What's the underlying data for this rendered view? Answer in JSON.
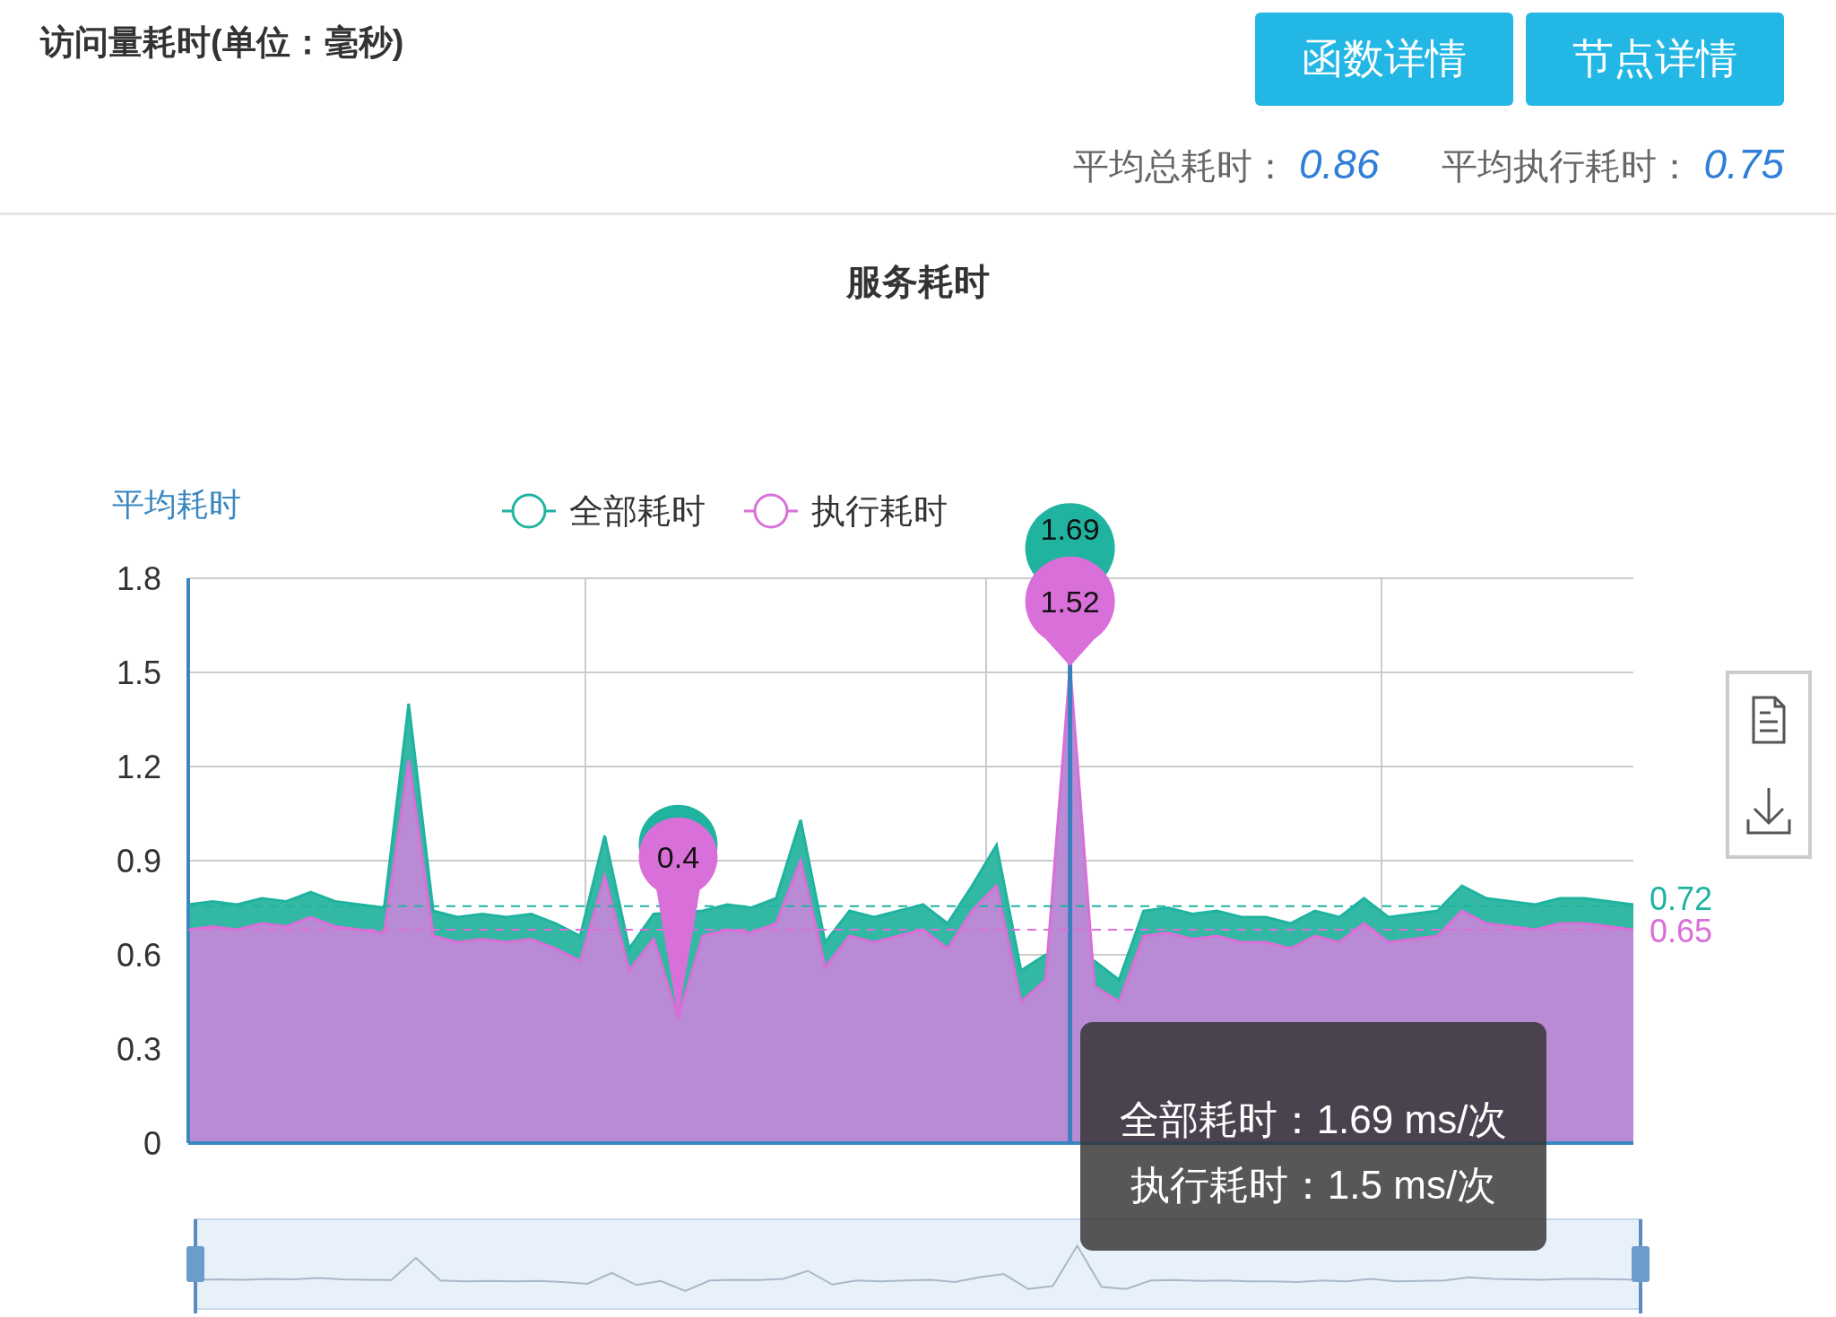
{
  "header": {
    "title": "访问量耗时(单位：毫秒)",
    "buttons": [
      "函数详情",
      "节点详情"
    ],
    "stats": [
      {
        "label": "平均总耗时：",
        "value": "0.86"
      },
      {
        "label": "平均执行耗时：",
        "value": "0.75"
      }
    ]
  },
  "chart": {
    "title": "服务耗时",
    "chart_data": {
      "type": "area",
      "ylabel": "平均耗时",
      "ylim": [
        0,
        1.8
      ],
      "yticks": [
        0,
        0.3,
        0.6,
        0.9,
        1.2,
        1.5,
        1.8
      ],
      "grid": true,
      "legend": true,
      "series": [
        {
          "name": "全部耗时",
          "color": "#1fb3a0",
          "values": [
            0.76,
            0.77,
            0.76,
            0.78,
            0.77,
            0.8,
            0.77,
            0.76,
            0.75,
            1.4,
            0.74,
            0.72,
            0.73,
            0.72,
            0.73,
            0.7,
            0.66,
            0.98,
            0.62,
            0.73,
            null,
            0.74,
            0.76,
            0.75,
            0.78,
            1.03,
            0.64,
            0.74,
            0.72,
            0.74,
            0.76,
            0.7,
            0.82,
            0.95,
            0.55,
            0.6,
            null,
            0.58,
            0.52,
            0.74,
            0.75,
            0.73,
            0.74,
            0.72,
            0.72,
            0.7,
            0.74,
            0.72,
            0.78,
            0.72,
            0.73,
            0.74,
            0.82,
            0.78,
            0.77,
            0.76,
            0.78,
            0.78,
            0.77,
            0.76
          ]
        },
        {
          "name": "执行耗时",
          "color": "#d96fd8",
          "values": [
            0.68,
            0.69,
            0.68,
            0.7,
            0.69,
            0.72,
            0.69,
            0.68,
            0.67,
            1.22,
            0.66,
            0.64,
            0.65,
            0.64,
            0.65,
            0.62,
            0.58,
            0.85,
            0.55,
            0.65,
            0.4,
            0.66,
            0.68,
            0.67,
            0.7,
            0.9,
            0.56,
            0.66,
            0.64,
            0.66,
            0.68,
            0.62,
            0.74,
            0.82,
            0.45,
            0.52,
            1.52,
            0.5,
            0.45,
            0.66,
            0.67,
            0.65,
            0.66,
            0.64,
            0.64,
            0.62,
            0.66,
            0.64,
            0.7,
            0.64,
            0.65,
            0.66,
            0.74,
            0.7,
            0.69,
            0.68,
            0.7,
            0.7,
            0.69,
            0.68
          ]
        }
      ]
    },
    "series_marks": [
      {
        "max": "1.69",
        "average": "0.72"
      },
      {
        "max": "1.52",
        "min": "0.4",
        "average": "0.65"
      }
    ],
    "tooltip": {
      "lines": [
        "全部耗时：1.69 ms/次",
        "执行耗时：1.5 ms/次"
      ]
    }
  }
}
